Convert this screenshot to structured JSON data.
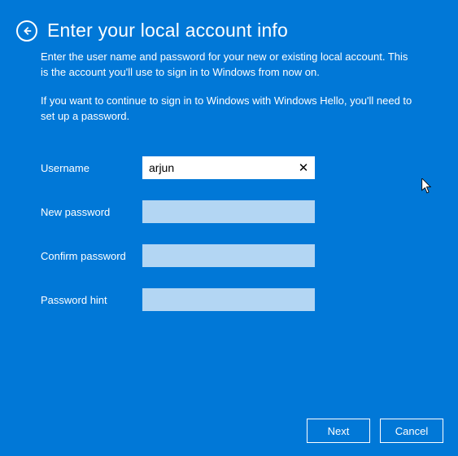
{
  "header": {
    "title": "Enter your local account info",
    "description1": "Enter the user name and password for your new or existing local account. This is the account you'll use to sign in to Windows from now on.",
    "description2": "If you want to continue to sign in to Windows with Windows Hello, you'll need to set up a password."
  },
  "form": {
    "username": {
      "label": "Username",
      "value": "arjun"
    },
    "newPassword": {
      "label": "New password",
      "value": ""
    },
    "confirmPassword": {
      "label": "Confirm password",
      "value": ""
    },
    "passwordHint": {
      "label": "Password hint",
      "value": ""
    }
  },
  "footer": {
    "next": "Next",
    "cancel": "Cancel"
  },
  "icons": {
    "back": "back-arrow-icon",
    "clear": "close-icon"
  }
}
